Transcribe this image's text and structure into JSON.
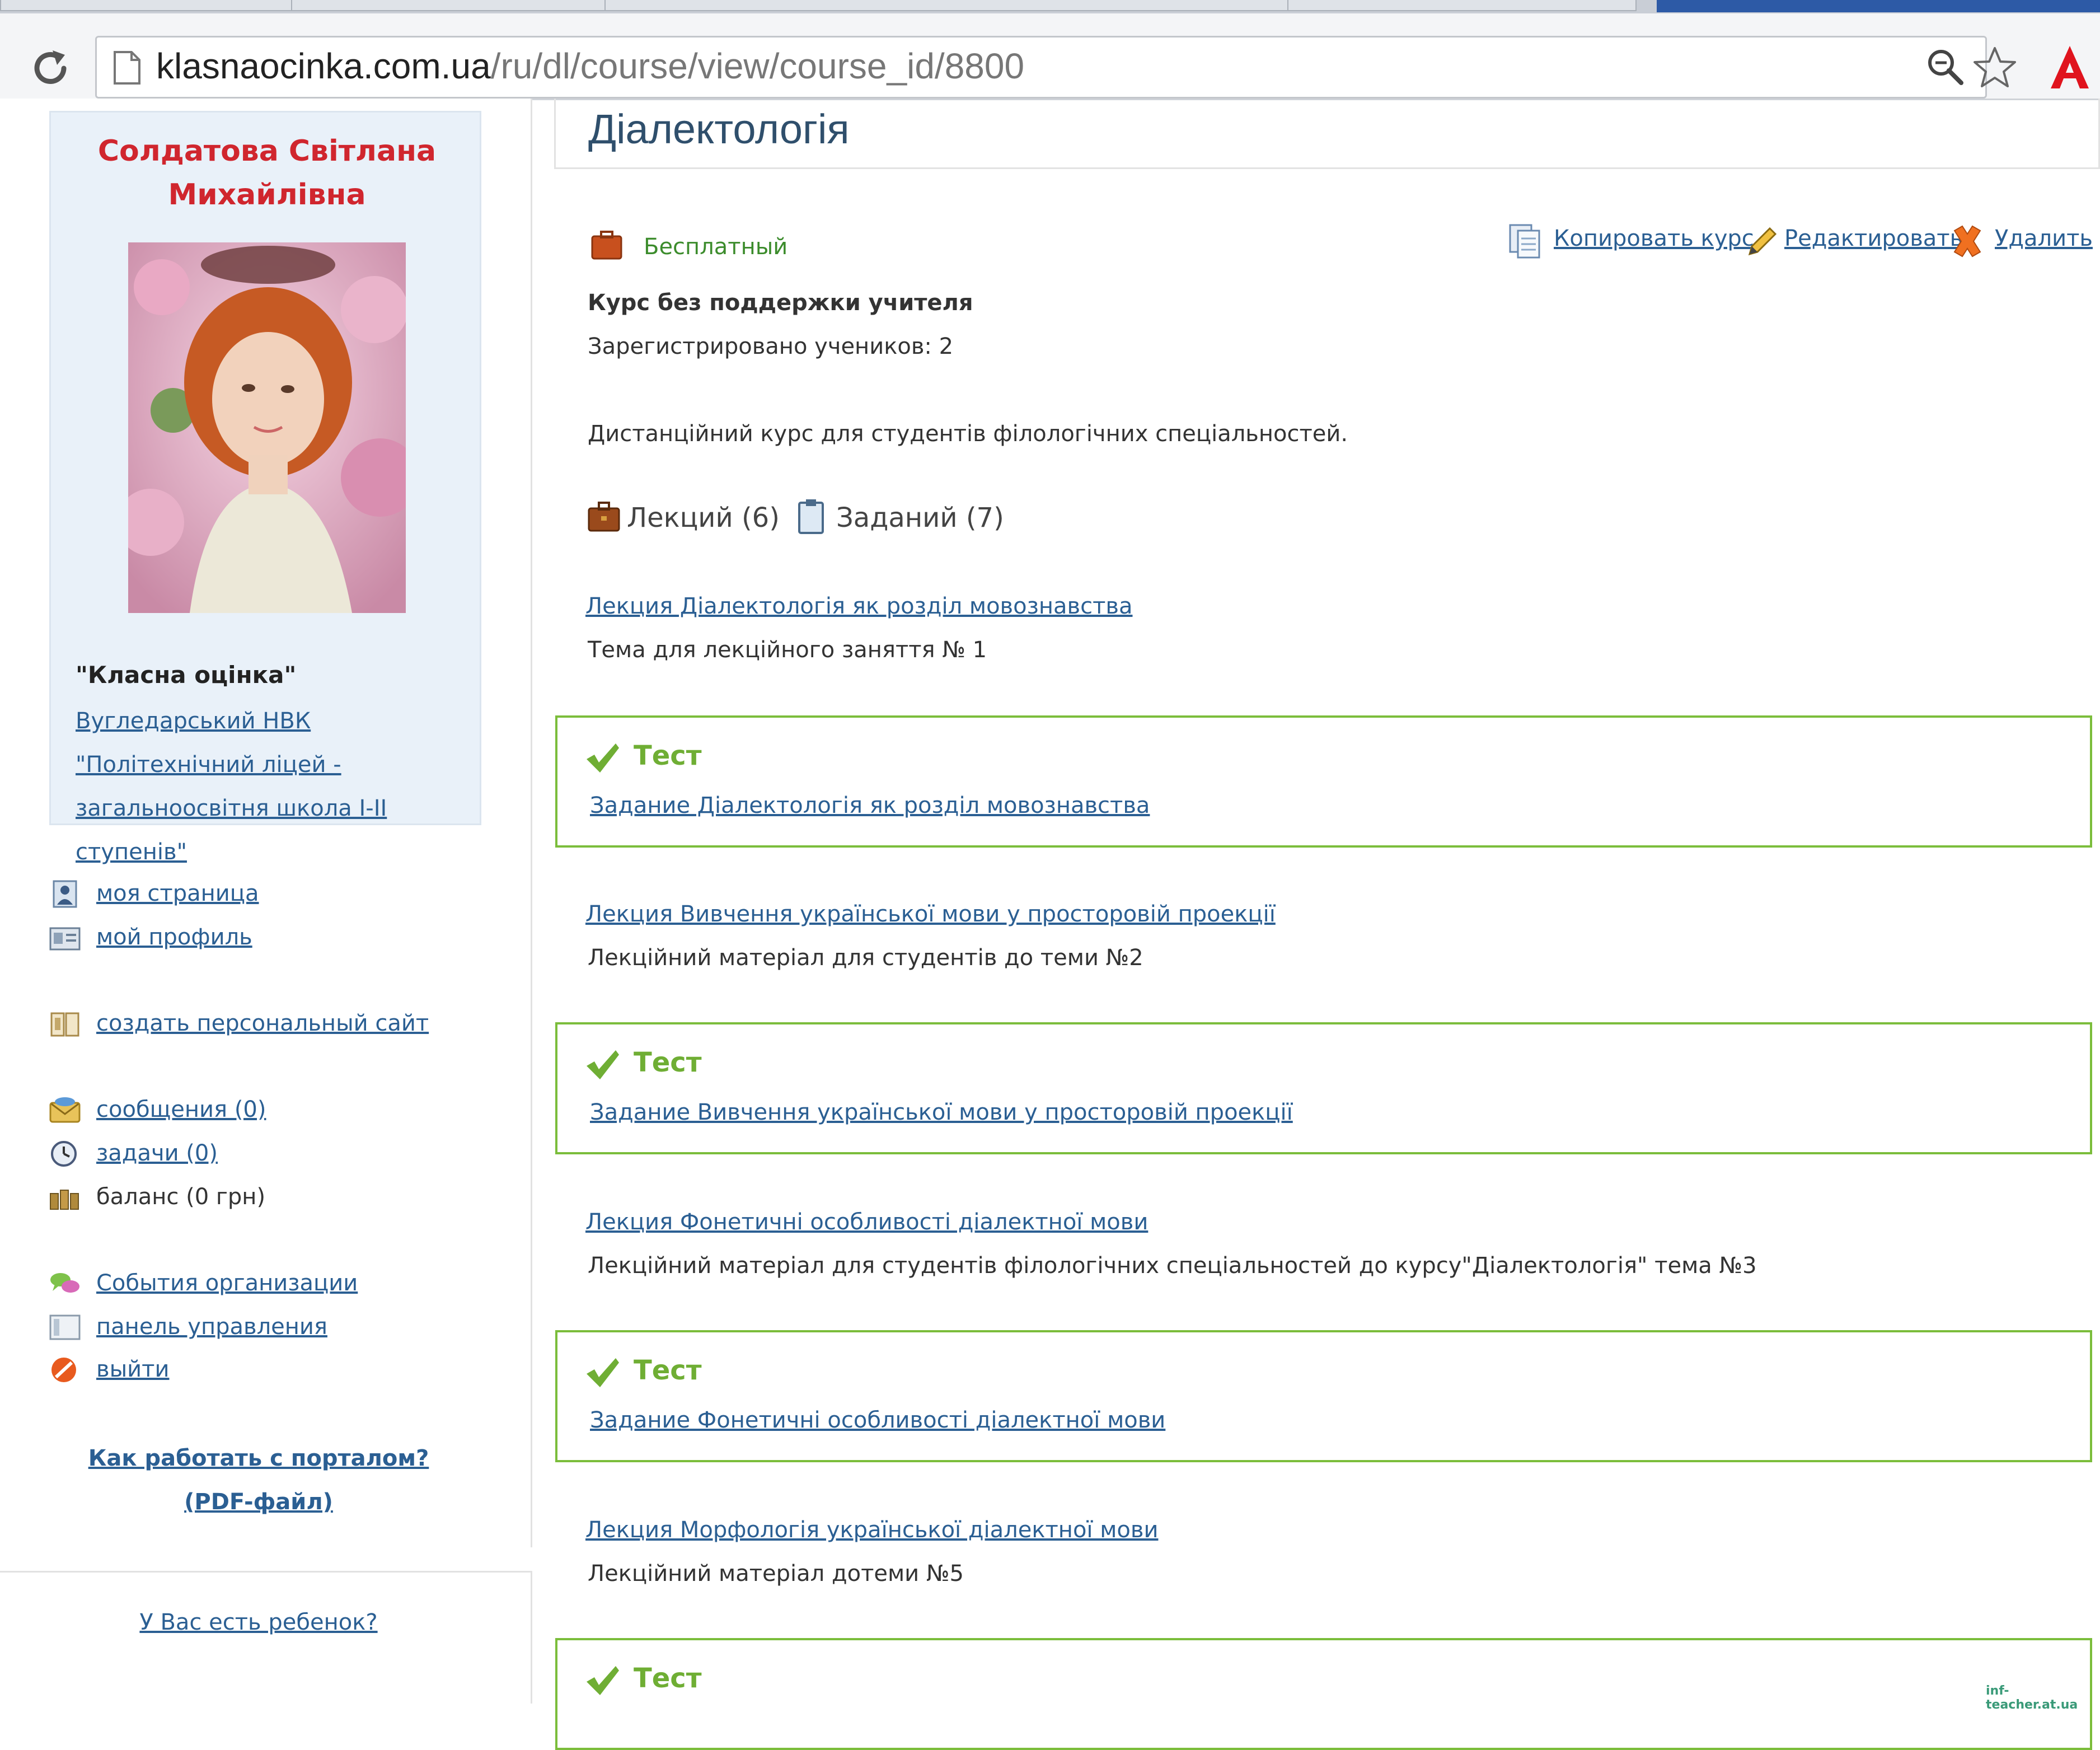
{
  "browser": {
    "url_host": "klasnaocinka.com.ua",
    "url_path": "/ru/dl/course/view/course_id/8800"
  },
  "sidebar": {
    "teacher_name_line1": "Солдатова Світлана",
    "teacher_name_line2": "Михайлівна",
    "org_title": "\"Класна оцінка\"",
    "school_link": "Вугледарський НВК \"Політехнічний ліцей - загальноосвітня школа І-ІІ ступенів\"",
    "menu": [
      {
        "label": "моя страница",
        "icon": "user-page-icon"
      },
      {
        "label": "мой профиль",
        "icon": "profile-card-icon"
      },
      {
        "label": "создать персональный сайт",
        "icon": "book-site-icon"
      },
      {
        "label": "сообщения (0)",
        "icon": "envelope-icon"
      },
      {
        "label": "задачи (0)",
        "icon": "clock-icon"
      },
      {
        "label": "баланс (0 грн)",
        "icon": "balance-icon"
      },
      {
        "label": "События организации",
        "icon": "chat-bubbles-icon"
      },
      {
        "label": "панель управления",
        "icon": "panel-icon"
      },
      {
        "label": "выйти",
        "icon": "logout-icon"
      }
    ],
    "help_line1": "Как работать с порталом?",
    "help_line2": "(PDF-файл)",
    "child_link": "У Вас есть ребенок?"
  },
  "course": {
    "title": "Діалектологія",
    "price_label": "Бесплатный",
    "actions": {
      "copy": "Копировать курс",
      "edit": "Редактировать",
      "delete": "Удалить"
    },
    "type": "Курс без поддержки учителя",
    "registered": "Зарегистрировано учеников: 2",
    "description": "Дистанційний курс для студентів філологічних спеціальностей.",
    "lectures_count": "Лекций (6)",
    "tasks_count": "Заданий (7)",
    "items": [
      {
        "lecture_link": "Лекция Діалектологія як розділ мовознавства",
        "lecture_desc": "Тема для лекційного заняття № 1",
        "test_title": "Тест",
        "test_link": "Задание Діалектологія як розділ мовознавства"
      },
      {
        "lecture_link": "Лекция Вивчення української мови у просторовій проекції",
        "lecture_desc": "Лекційний матеріал для студентів до теми №2",
        "test_title": "Тест",
        "test_link": "Задание Вивчення української мови у просторовій проекції"
      },
      {
        "lecture_link": "Лекция Фонетичні особливості діалектної мови",
        "lecture_desc": "Лекційний матеріал для студентів філологічних спеціальностей до курсу\"Діалектологія\" тема №3",
        "test_title": "Тест",
        "test_link": "Задание Фонетичні особливості діалектної мови"
      },
      {
        "lecture_link": "Лекция Морфологія української діалектної мови",
        "lecture_desc": "Лекційний матеріал дотеми №5",
        "test_title": "Тест"
      }
    ]
  },
  "watermark": "inf-teacher.at.ua",
  "colors": {
    "teacher_name": "#d0262e",
    "link": "#2b5f93",
    "test_border": "#7bbd3b",
    "test_title": "#6fae34",
    "free_label": "#3c8c2c",
    "profile_bg": "#e9f1f9"
  }
}
